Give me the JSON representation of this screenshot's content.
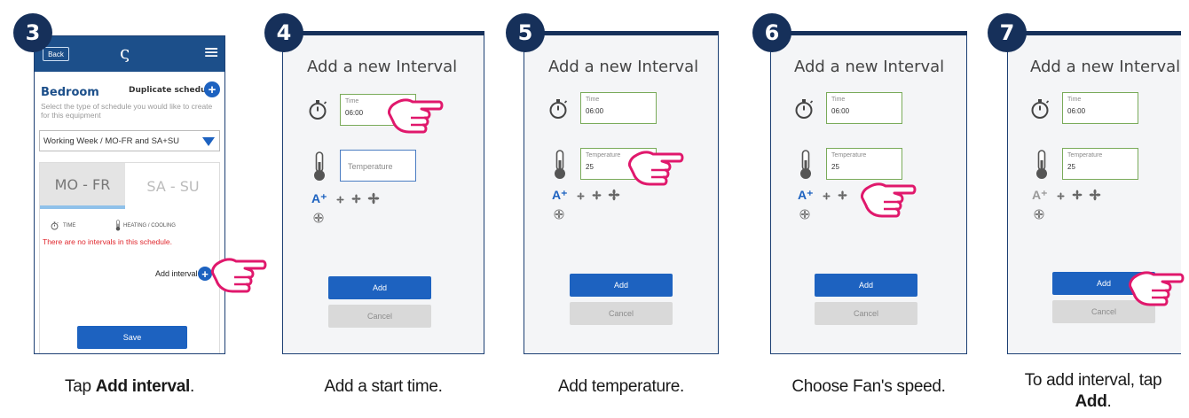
{
  "steps": [
    {
      "num": "3",
      "caption_pre": "Tap ",
      "caption_bold": "Add interval",
      "caption_post": "."
    },
    {
      "num": "4",
      "caption": "Add a start time."
    },
    {
      "num": "5",
      "caption": "Add temperature."
    },
    {
      "num": "6",
      "caption": "Choose Fan's speed."
    },
    {
      "num": "7",
      "caption_line1": "To add interval, tap",
      "caption_bold": "Add",
      "caption_post": "."
    }
  ],
  "phone": {
    "back_label": "Back",
    "logo_glyph": "ς",
    "menu_glyph": "≡",
    "room": "Bedroom",
    "duplicate_label": "Duplicate schedule",
    "help_text": "Select the type of schedule you would like to create for this equipment",
    "schedule_select": "Working Week / MO-FR and SA+SU",
    "tab_active": "MO - FR",
    "tab_inactive": "SA - SU",
    "col_time": "TIME",
    "col_heating": "HEATING / COOLING",
    "empty_msg": "There are no intervals in this schedule.",
    "add_interval_label": "Add interval",
    "save_label": "Save"
  },
  "dialog": {
    "title": "Add a new Interval",
    "time_label": "Time",
    "time_value": "06:00",
    "temp_label": "Temperature",
    "temp_placeholder": "Temperature",
    "temp_value": "25",
    "auto_glyph": "A⁺",
    "add_label": "Add",
    "cancel_label": "Cancel"
  },
  "colors": {
    "accent": "#1d62c0",
    "navy": "#16305a",
    "error": "#e0282e",
    "hand": "#e0186c",
    "field_ok": "#7aab5a"
  }
}
